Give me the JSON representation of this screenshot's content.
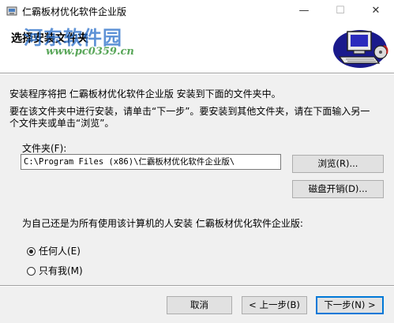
{
  "window": {
    "title": "仁霸板材优化软件企业版",
    "minimize_glyph": "—",
    "maximize_glyph": "☐",
    "close_glyph": "✕"
  },
  "banner": {
    "heading": "选择安装文件夹",
    "watermark_name": "河东软件园",
    "watermark_url": "www.pc0359.cn"
  },
  "body": {
    "line1": "安装程序将把 仁霸板材优化软件企业版 安装到下面的文件夹中。",
    "line2": "要在该文件夹中进行安装，请单击“下一步”。要安装到其他文件夹，请在下面输入另一",
    "line3": "个文件夹或单击“浏览”。",
    "folder_label": "文件夹(F):",
    "folder_value": "C:\\Program Files (x86)\\仁霸板材优化软件企业版\\",
    "browse_button": "浏览(R)...",
    "disk_cost_button": "磁盘开销(D)...",
    "question": "为自己还是为所有使用该计算机的人安装 仁霸板材优化软件企业版:",
    "radio_everyone": "任何人(E)",
    "radio_just_me": "只有我(M)",
    "selected_radio": "everyone"
  },
  "footer": {
    "cancel_button": "取消",
    "back_button": "< 上一步(B)",
    "next_button": "下一步(N) >"
  },
  "icons": [
    "app-icon",
    "computer-setup-icon"
  ]
}
